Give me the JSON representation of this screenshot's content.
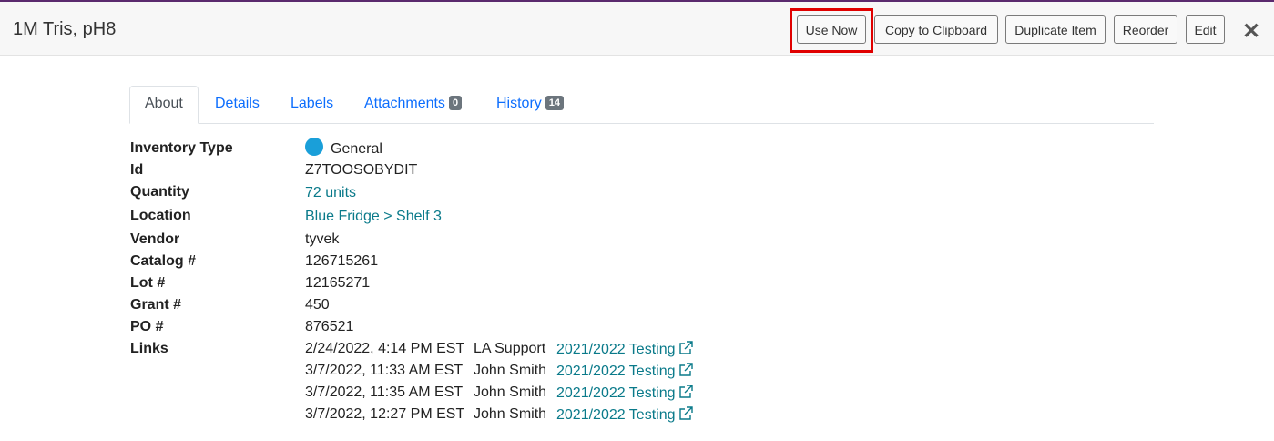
{
  "header": {
    "title": "1M Tris, pH8",
    "buttons": {
      "use_now": "Use Now",
      "copy": "Copy to Clipboard",
      "duplicate": "Duplicate Item",
      "reorder": "Reorder",
      "edit": "Edit"
    },
    "close_glyph": "✕"
  },
  "tabs": [
    {
      "label": "About",
      "active": true
    },
    {
      "label": "Details"
    },
    {
      "label": "Labels"
    },
    {
      "label": "Attachments",
      "badge": "0"
    },
    {
      "label": "History",
      "badge": "14"
    }
  ],
  "fields": {
    "inventory_type": {
      "label": "Inventory Type",
      "value": "General",
      "color": "#1a9fd9"
    },
    "id": {
      "label": "Id",
      "value": "Z7TOOSOBYDIT"
    },
    "quantity": {
      "label": "Quantity",
      "value": "72 units"
    },
    "location": {
      "label": "Location",
      "value": "Blue Fridge > Shelf 3"
    },
    "vendor": {
      "label": "Vendor",
      "value": "tyvek"
    },
    "catalog": {
      "label": "Catalog #",
      "value": "126715261"
    },
    "lot": {
      "label": "Lot #",
      "value": "12165271"
    },
    "grant": {
      "label": "Grant #",
      "value": "450"
    },
    "po": {
      "label": "PO #",
      "value": "876521"
    },
    "links_label": "Links"
  },
  "links": [
    {
      "date": "2/24/2022, 4:14 PM EST",
      "user": "LA Support",
      "title": "2021/2022 Testing"
    },
    {
      "date": "3/7/2022, 11:33 AM EST",
      "user": "John Smith",
      "title": "2021/2022 Testing"
    },
    {
      "date": "3/7/2022, 11:35 AM EST",
      "user": "John Smith",
      "title": "2021/2022 Testing"
    },
    {
      "date": "3/7/2022, 12:27 PM EST",
      "user": "John Smith",
      "title": "2021/2022 Testing"
    }
  ],
  "icons": {
    "external": "external-link-icon",
    "close": "close-icon"
  },
  "colors": {
    "highlight": "#e00000",
    "link": "#0a7a8a",
    "tab_link": "#0d6efd"
  }
}
